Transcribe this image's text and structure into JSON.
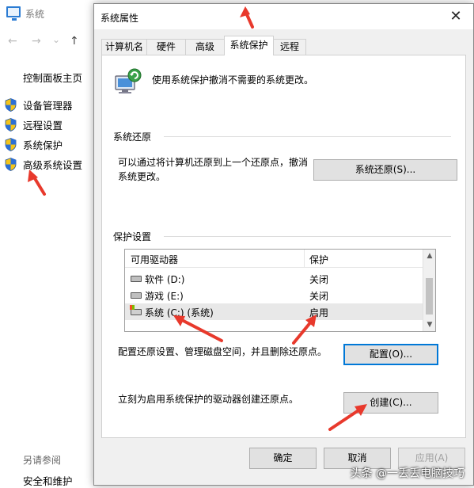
{
  "background_window": {
    "title": "系统",
    "nav": {
      "back": "←",
      "forward": "→",
      "dropdown": "⌄",
      "up": "↑"
    },
    "sidebar_home": "控制面板主页",
    "links": [
      "设备管理器",
      "远程设置",
      "系统保护",
      "高级系统设置"
    ],
    "see_also_title": "另请参阅",
    "see_also_item": "安全和维护"
  },
  "dialog": {
    "title": "系统属性",
    "close": "✕",
    "tabs": [
      "计算机名",
      "硬件",
      "高级",
      "系统保护",
      "远程"
    ],
    "active_tab": "系统保护",
    "header_text": "使用系统保护撤消不需要的系统更改。",
    "restore": {
      "group_label": "系统还原",
      "description_line1": "可以通过将计算机还原到上一个还原点，撤消",
      "description_line2": "系统更改。",
      "button": "系统还原(S)..."
    },
    "protection": {
      "group_label": "保护设置",
      "columns": [
        "可用驱动器",
        "保护"
      ],
      "drives": [
        {
          "name": "软件 (D:)",
          "protection": "关闭",
          "type": "disk"
        },
        {
          "name": "游戏 (E:)",
          "protection": "关闭",
          "type": "disk"
        },
        {
          "name": "系统 (C:) (系统)",
          "protection": "启用",
          "type": "system"
        }
      ],
      "configure_text": "配置还原设置、管理磁盘空间，并且删除还原点。",
      "configure_button": "配置(O)...",
      "create_text": "立刻为启用系统保护的驱动器创建还原点。",
      "create_button": "创建(C)..."
    },
    "footer": {
      "ok": "确定",
      "cancel": "取消",
      "apply": "应用(A)"
    }
  },
  "watermark": "头条 @一丢丢电脑技巧",
  "colors": {
    "annotation_arrow": "#e8392c",
    "focus_blue": "#0078d7",
    "shield_blue": "#2b6fd6",
    "shield_yellow": "#f5c518"
  }
}
